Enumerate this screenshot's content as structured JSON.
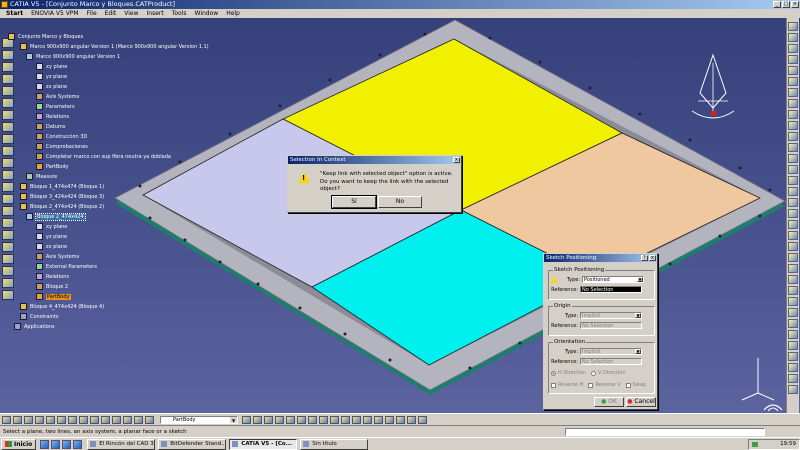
{
  "window": {
    "title": "CATIA V5 - [Conjunto Marco y Bloques.CATProduct]",
    "min": "_",
    "max": "□",
    "close": "×"
  },
  "menu": [
    "Start",
    "ENOVIA V5 VPM",
    "File",
    "Edit",
    "View",
    "Insert",
    "Tools",
    "Window",
    "Help"
  ],
  "tree": {
    "root": "Conjunto Marco y Bloques",
    "marco": "Marco 900x900 angular Version 1 (Marco 900x900 angular Version 1.1)",
    "marco_part": "Marco 900x900 angular Version 1",
    "xy": "xy plane",
    "yz": "yz plane",
    "zx": "zx plane",
    "axis": "Axis Systems",
    "params": "Parameters",
    "relations": "Relations",
    "datums": "Datums",
    "construccion": "Construccion 3D",
    "comprobaciones": "Comprobaciones",
    "completar": "Completar marco con sup fibra neutra ya doblada",
    "partbody": "PartBody",
    "measure": "Measure",
    "bloque1": "Bloque 1_474x474 (Bloque 1)",
    "bloque3": "Bloque 3_424x424 (Bloque 3)",
    "bloque2": "Bloque 2_474x424 (Bloque 2)",
    "bloque2_part": "Bloque 2_474x424",
    "xy2": "xy plane",
    "yz2": "yz plane",
    "zx2": "zx plane",
    "axis2": "Axis Systems",
    "ext_params": "External Parameters",
    "relations2": "Relations",
    "bloque2_body": "Bloque 2",
    "partbody2": "PartBody",
    "bloque4": "Bloque 4_474x424 (Bloque 4)",
    "constraints": "Constraints",
    "applications": "Applications"
  },
  "dialog": {
    "title": "Selection In Context",
    "line1": "\"Keep link with selected object\" option is active.",
    "line2": "Do you want to keep the link with the selected object?",
    "yes": "Sí",
    "no": "No"
  },
  "sketch_positioning": {
    "title": "Sketch Positioning",
    "group1": "Sketch Positioning",
    "type_label": "Type:",
    "type_value": "Positioned",
    "ref_label": "Reference:",
    "ref_value": "No Selection",
    "origin_group": "Origin",
    "origin_type_label": "Type:",
    "origin_type_value": "Implicit",
    "origin_ref_label": "Reference:",
    "origin_ref_value": "No Selection",
    "orient_group": "Orientation",
    "orient_type_label": "Type:",
    "orient_type_value": "Implicit",
    "orient_ref_label": "Reference:",
    "orient_ref_value": "No Selection",
    "h_dir": "H Direction",
    "v_dir": "V Direction",
    "rev_h": "Reverse H",
    "rev_v": "Reverse V",
    "swap": "Swap",
    "ok": "OK",
    "cancel": "Cancel"
  },
  "toolbar": {
    "part_combo": "PartBody"
  },
  "status": {
    "prompt": "Select a plane, two lines, an axis system, a planar face or a sketch"
  },
  "taskbar": {
    "start": "Inicio",
    "tasks": [
      "El Rincón del CAD 3...",
      "BitDefender Stand...",
      "CATIA V5 - [Co...",
      "Sin título"
    ],
    "clock": "19:59"
  },
  "colors": {
    "viewport_bg": "#36407a",
    "panel_yellow": "#f0f000",
    "panel_peach": "#f0c8a0",
    "panel_lavender": "#c8c8ec",
    "panel_cyan": "#00f0f0",
    "frame": "#b4b4be",
    "frame_base": "#1e7e6e",
    "title_blue": "#0a246a"
  },
  "icons": [
    "catia-app-icon",
    "compass-icon",
    "axis-triad-icon",
    "dassault-logo-icon",
    "warning-icon",
    "windows-start-icon"
  ]
}
